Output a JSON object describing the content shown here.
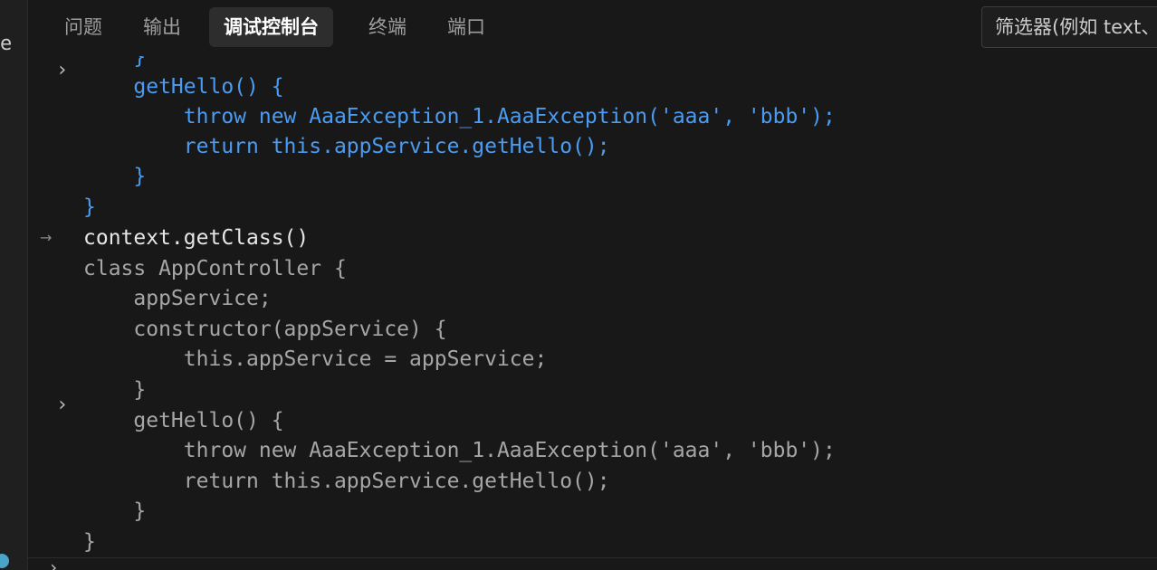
{
  "left_strip": {
    "char": "e"
  },
  "tabs": [
    {
      "label": "问题",
      "active": false
    },
    {
      "label": "输出",
      "active": false
    },
    {
      "label": "调试控制台",
      "active": true
    },
    {
      "label": "终端",
      "active": false
    },
    {
      "label": "端口",
      "active": false
    }
  ],
  "filter": {
    "placeholder": "筛选器(例如 text、!exclude)"
  },
  "console": {
    "expand_icon": "chevron-right-icon",
    "input_marker_icon": "arrow-right-icon",
    "lines": [
      "    }",
      "    getHello() {",
      "        throw new AaaException_1.AaaException('aaa', 'bbb');",
      "        return this.appService.getHello();",
      "    }",
      "}",
      "context.getClass()",
      "class AppController {",
      "    appService;",
      "    constructor(appService) {",
      "        this.appService = appService;",
      "    }",
      "    getHello() {",
      "        throw new AaaException_1.AaaException('aaa', 'bbb');",
      "        return this.appService.getHello();",
      "    }",
      "}"
    ]
  },
  "colors": {
    "output_text": "#4b9bf0",
    "result_text": "#a6a6a6",
    "input_text": "#e6e6e6",
    "background": "#181818"
  }
}
